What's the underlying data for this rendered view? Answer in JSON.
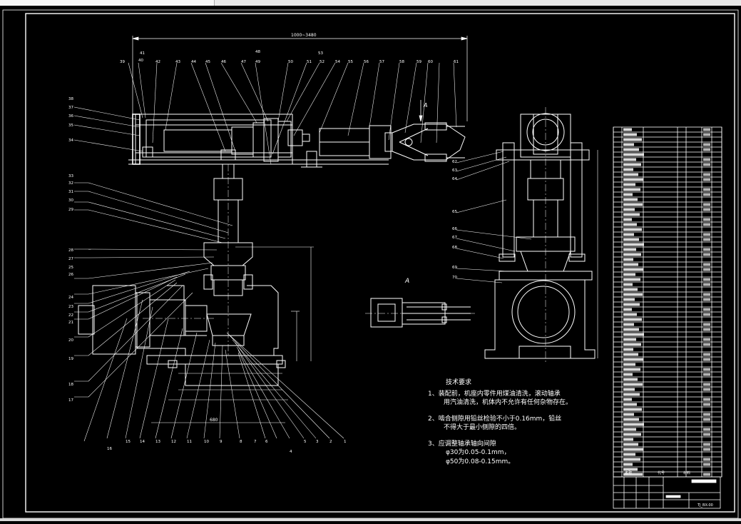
{
  "window": {
    "canvas_bg": "#000000",
    "line_color": "#ffffff",
    "bar_color": "#e8e8e8"
  },
  "view_labels": {
    "section_a": "A",
    "arrow_a": "A"
  },
  "dimensions": {
    "top_stroke": "1000~3480",
    "bottom_base": "680"
  },
  "balloons": [
    "1",
    "2",
    "3",
    "4",
    "5",
    "6",
    "7",
    "8",
    "9",
    "10",
    "11",
    "12",
    "13",
    "14",
    "15",
    "16",
    "17",
    "18",
    "19",
    "20",
    "21",
    "22",
    "23",
    "24",
    "25",
    "26",
    "27",
    "28",
    "29",
    "30",
    "31",
    "32",
    "33",
    "34",
    "35",
    "36",
    "37",
    "38",
    "39",
    "40",
    "41",
    "42",
    "43",
    "44",
    "45",
    "46",
    "47",
    "48",
    "49",
    "50",
    "51",
    "52",
    "53",
    "54",
    "55",
    "56",
    "57",
    "58",
    "59",
    "60",
    "61",
    "62",
    "63",
    "64",
    "65",
    "66",
    "67",
    "68",
    "69",
    "70"
  ],
  "tech_requirements": {
    "title": "技术要求",
    "items": [
      {
        "num": "1、",
        "line1": "装配前，机座内零件用煤油清洗，滚动轴承",
        "line2": "用汽油清洗，机体内不允许有任何杂物存在。"
      },
      {
        "num": "2、",
        "line1": "啮合侧隙用铅丝检验不小于0.16mm，铅丝",
        "line2": "不得大于最小侧隙的四倍。"
      },
      {
        "num": "3、",
        "line1": "应调整轴承轴向间隙",
        "m1": "φ30为0.05-0.1mm，",
        "m2": "φ50为0.08-0.15mm。"
      }
    ]
  },
  "title_block": {
    "label_name": "名称",
    "label_code": "代号",
    "label_material": "材料",
    "drawing_no": "TJ_BX-00"
  }
}
